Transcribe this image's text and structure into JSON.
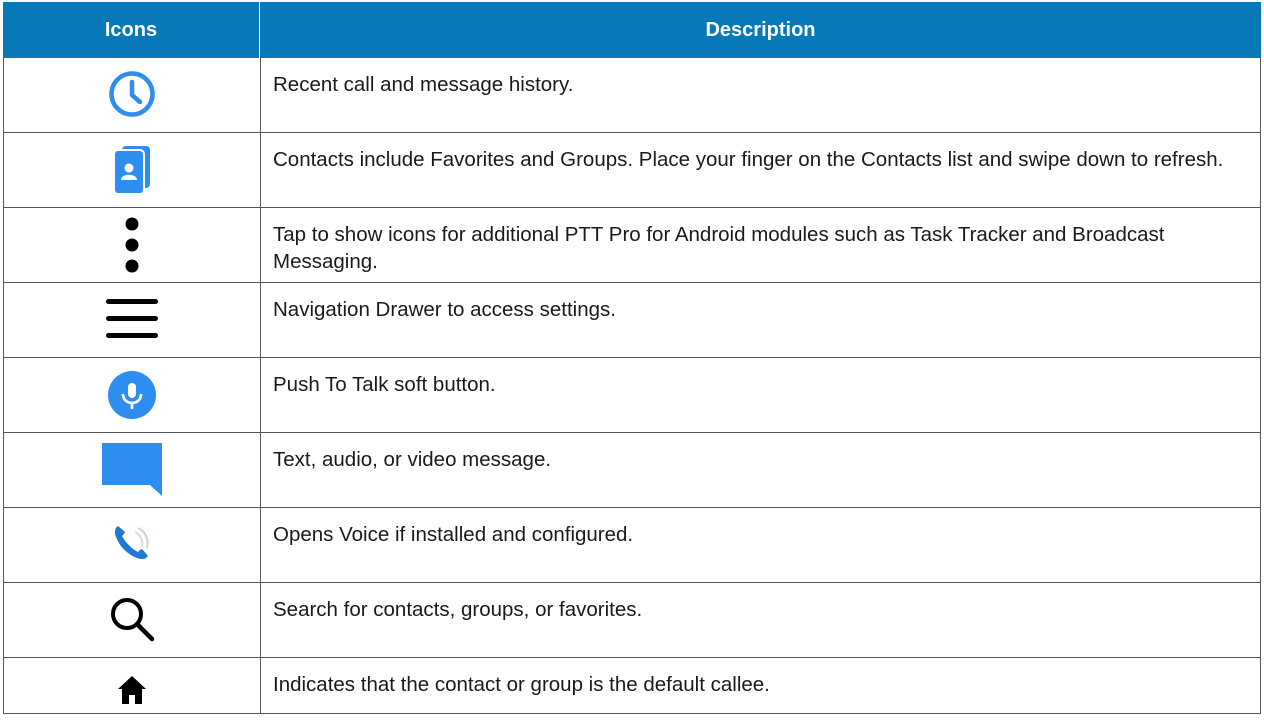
{
  "header": {
    "icons": "Icons",
    "description": "Description"
  },
  "rows": [
    {
      "icon": "clock-icon",
      "text": "Recent call and message history."
    },
    {
      "icon": "contacts-icon",
      "text": "Contacts include Favorites and Groups. Place your finger on the Contacts list and swipe down to refresh."
    },
    {
      "icon": "more-vertical-icon",
      "text": "Tap to show icons for additional PTT Pro for Android modules such as Task Tracker and Broadcast Messaging."
    },
    {
      "icon": "menu-icon",
      "text": "Navigation Drawer to access settings."
    },
    {
      "icon": "microphone-icon",
      "text": "Push To Talk soft button."
    },
    {
      "icon": "message-icon",
      "text": "Text, audio, or video message."
    },
    {
      "icon": "voice-phone-icon",
      "text": "Opens Voice if installed and configured."
    },
    {
      "icon": "search-icon",
      "text": "Search for contacts, groups, or favorites."
    },
    {
      "icon": "home-icon",
      "text": "Indicates that the contact or group is the default callee."
    }
  ],
  "colors": {
    "header": "#0778b8",
    "icon_blue": "#2e8ef0"
  }
}
